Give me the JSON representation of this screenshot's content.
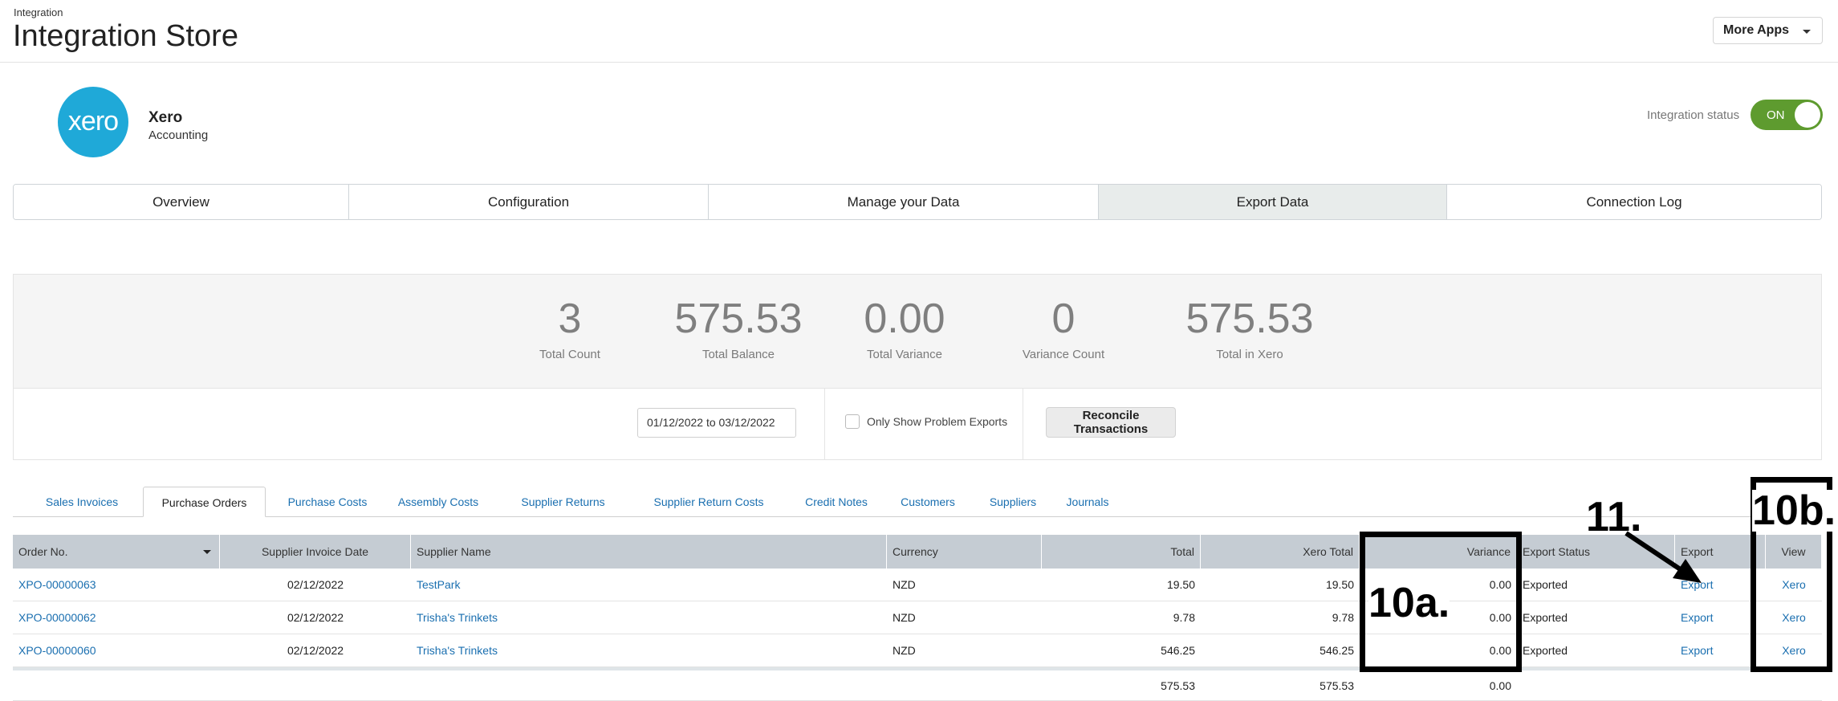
{
  "header": {
    "breadcrumb": "Integration",
    "title": "Integration Store",
    "more_apps_label": "More Apps"
  },
  "app": {
    "logo_text": "xero",
    "name": "Xero",
    "category": "Accounting",
    "status_label": "Integration status",
    "status_value": "ON"
  },
  "main_tabs": [
    {
      "label": "Overview"
    },
    {
      "label": "Configuration"
    },
    {
      "label": "Manage your Data"
    },
    {
      "label": "Export Data"
    },
    {
      "label": "Connection Log"
    }
  ],
  "summary": [
    {
      "value": "3",
      "label": "Total Count"
    },
    {
      "value": "575.53",
      "label": "Total Balance"
    },
    {
      "value": "0.00",
      "label": "Total Variance"
    },
    {
      "value": "0",
      "label": "Variance Count"
    },
    {
      "value": "575.53",
      "label": "Total in Xero"
    }
  ],
  "filters": {
    "date_range": "01/12/2022 to 03/12/2022",
    "only_problem_label": "Only Show Problem Exports",
    "reconcile_label": "Reconcile Transactions"
  },
  "sub_tabs": [
    {
      "label": "Sales Invoices"
    },
    {
      "label": "Purchase Orders"
    },
    {
      "label": "Purchase Costs"
    },
    {
      "label": "Assembly Costs"
    },
    {
      "label": "Supplier Returns"
    },
    {
      "label": "Supplier Return Costs"
    },
    {
      "label": "Credit Notes"
    },
    {
      "label": "Customers"
    },
    {
      "label": "Suppliers"
    },
    {
      "label": "Journals"
    }
  ],
  "table": {
    "columns": [
      "Order No.",
      "Supplier Invoice Date",
      "Supplier Name",
      "Currency",
      "Total",
      "Xero Total",
      "Variance",
      "Export Status",
      "Export",
      "View"
    ],
    "rows": [
      {
        "order_no": "XPO-00000063",
        "date": "02/12/2022",
        "supplier": "TestPark",
        "currency": "NZD",
        "total": "19.50",
        "xero_total": "19.50",
        "variance": "0.00",
        "status": "Exported",
        "export": "Export",
        "view": "Xero"
      },
      {
        "order_no": "XPO-00000062",
        "date": "02/12/2022",
        "supplier": "Trisha's Trinkets",
        "currency": "NZD",
        "total": "9.78",
        "xero_total": "9.78",
        "variance": "0.00",
        "status": "Exported",
        "export": "Export",
        "view": "Xero"
      },
      {
        "order_no": "XPO-00000060",
        "date": "02/12/2022",
        "supplier": "Trisha's Trinkets",
        "currency": "NZD",
        "total": "546.25",
        "xero_total": "546.25",
        "variance": "0.00",
        "status": "Exported",
        "export": "Export",
        "view": "Xero"
      }
    ],
    "totals": {
      "total": "575.53",
      "xero_total": "575.53",
      "variance": "0.00"
    }
  },
  "annotations": {
    "variance_label": "10a.",
    "view_label": "10b.",
    "export_label": "11."
  }
}
